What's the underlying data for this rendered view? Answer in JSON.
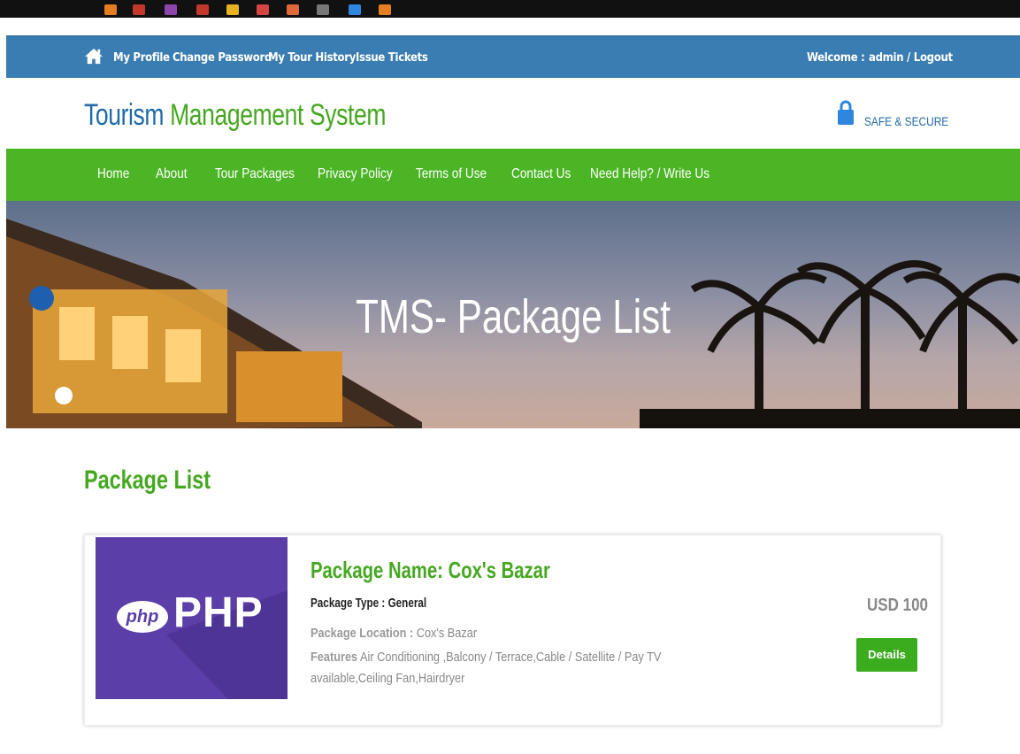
{
  "topbar": {
    "links": [
      "My Profile",
      "Change Password",
      "My Tour History",
      "Issue Tickets"
    ],
    "welcome": "Welcome :",
    "user_logout": "admin / Logout"
  },
  "header": {
    "brand_part1": "Tourism",
    "brand_part2": "Management System",
    "secure_label": "SAFE & SECURE"
  },
  "nav": {
    "items": [
      "Home",
      "About",
      "Tour Packages",
      "Privacy Policy",
      "Terms of Use",
      "Contact Us",
      "Need Help? / Write Us"
    ]
  },
  "banner": {
    "title": "TMS- Package List"
  },
  "main": {
    "section_title": "Package List",
    "packages": [
      {
        "image_logo": "php",
        "image_text": "PHP",
        "name": "Package Name: Cox's Bazar",
        "type": "Package Type : General",
        "location_label": "Package Location :",
        "location_value": "Cox's Bazar",
        "features_label": "Features",
        "features_value": "Air Conditioning ,Balcony / Terrace,Cable / Satellite / Pay TV available,Ceiling Fan,Hairdryer",
        "price": "USD 100",
        "details_label": "Details"
      }
    ]
  },
  "colors": {
    "topbar_blue": "#3a7db2",
    "brand_blue": "#1f6aa8",
    "brand_green": "#45a820",
    "nav_green": "#4cb526",
    "button_green": "#3cac1f",
    "php_purple": "#5b3ea8"
  },
  "icons": [
    "home-icon",
    "lock-icon"
  ]
}
